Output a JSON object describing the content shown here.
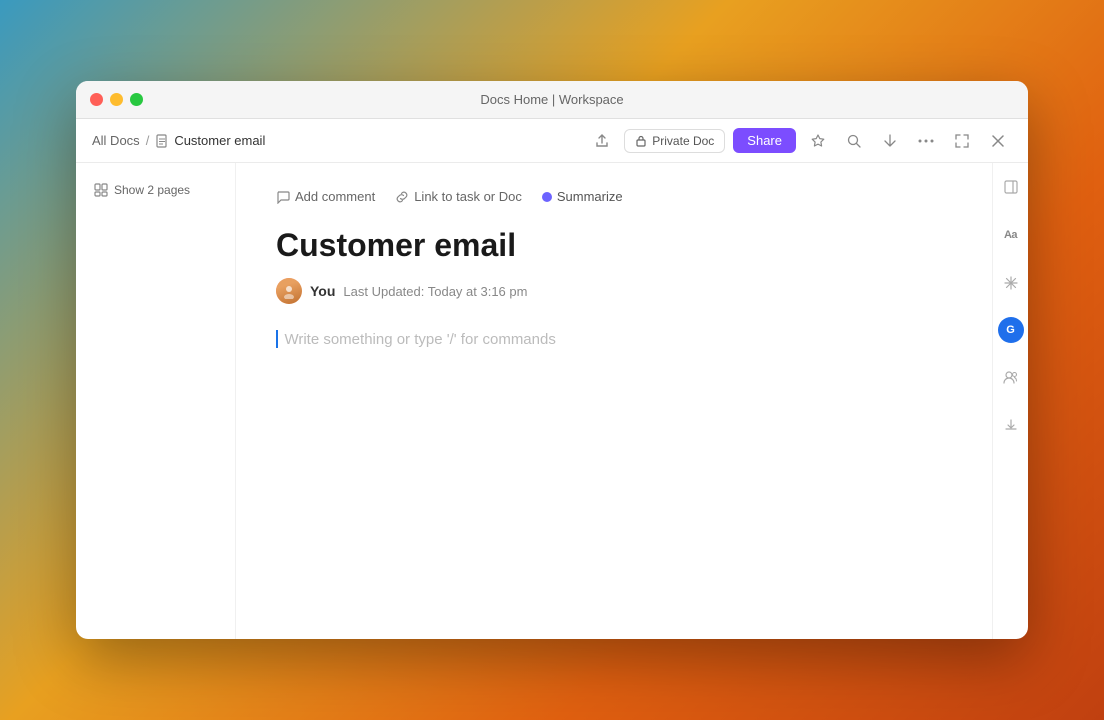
{
  "window": {
    "title": "Docs Home | Workspace"
  },
  "titlebar": {
    "title": "Docs Home | Workspace"
  },
  "breadcrumb": {
    "all_docs": "All Docs",
    "separator": "/",
    "current": "Customer email"
  },
  "topbar": {
    "private_doc_label": "Private Doc",
    "share_label": "Share"
  },
  "sidebar": {
    "show_pages_label": "Show 2 pages"
  },
  "doc_toolbar": {
    "add_comment": "Add comment",
    "link_task": "Link to task or Doc",
    "summarize": "Summarize"
  },
  "doc": {
    "title": "Customer email",
    "author": "You",
    "last_updated": "Last Updated: Today at 3:16 pm",
    "placeholder": "Write something or type '/' for commands"
  },
  "icons": {
    "doc": "📄",
    "pages": "⊞",
    "comment": "💬",
    "link": "🔗",
    "star": "☆",
    "search": "🔍",
    "share_arrow": "→",
    "more": "···",
    "expand": "⤢",
    "close": "✕",
    "lock": "🔒",
    "text_size": "Aa",
    "snowflake": "❄",
    "person_circle": "👤",
    "download": "⬇"
  },
  "colors": {
    "share_btn": "#7c4dff",
    "summarize_dot": "#6c63ff",
    "ai_fab": "#1f6feb",
    "title_text": "#1a1a1a",
    "placeholder_text": "#bbb"
  }
}
